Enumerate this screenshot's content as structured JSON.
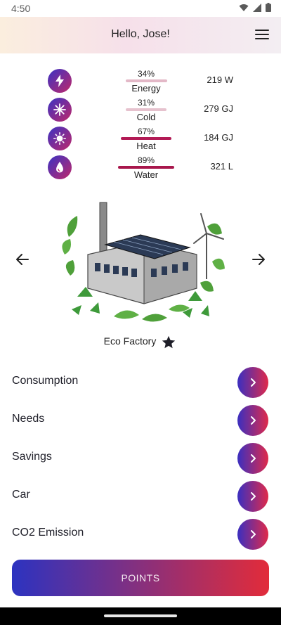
{
  "status_bar": {
    "time": "4:50"
  },
  "header": {
    "greeting": "Hello, Jose!"
  },
  "metrics": [
    {
      "name": "Energy",
      "percent": "34%",
      "value": "219 W",
      "icon": "lightning-bolt-icon",
      "bar_color": "#e3b8c7"
    },
    {
      "name": "Cold",
      "percent": "31%",
      "value": "279 GJ",
      "icon": "snowflake-icon",
      "bar_color": "#e6c2ce"
    },
    {
      "name": "Heat",
      "percent": "67%",
      "value": "184 GJ",
      "icon": "sun-icon",
      "bar_color": "#b21a55"
    },
    {
      "name": "Water",
      "percent": "89%",
      "value": "321 L",
      "icon": "water-drop-icon",
      "bar_color": "#a8174c"
    }
  ],
  "carousel": {
    "title": "Eco Factory",
    "illustration": "eco-factory-illustration",
    "favorite_icon": "star-icon"
  },
  "nav_items": [
    {
      "label": "Consumption"
    },
    {
      "label": "Needs"
    },
    {
      "label": "Savings"
    },
    {
      "label": "Car"
    },
    {
      "label": "CO2 Emission"
    }
  ],
  "points_button": {
    "label": "POINTS"
  },
  "colors": {
    "gradient_start": "#2c33c0",
    "gradient_end": "#e22c3a",
    "header_gradient": [
      "#fbeede",
      "#f6e0ea",
      "#f3eef2"
    ]
  }
}
